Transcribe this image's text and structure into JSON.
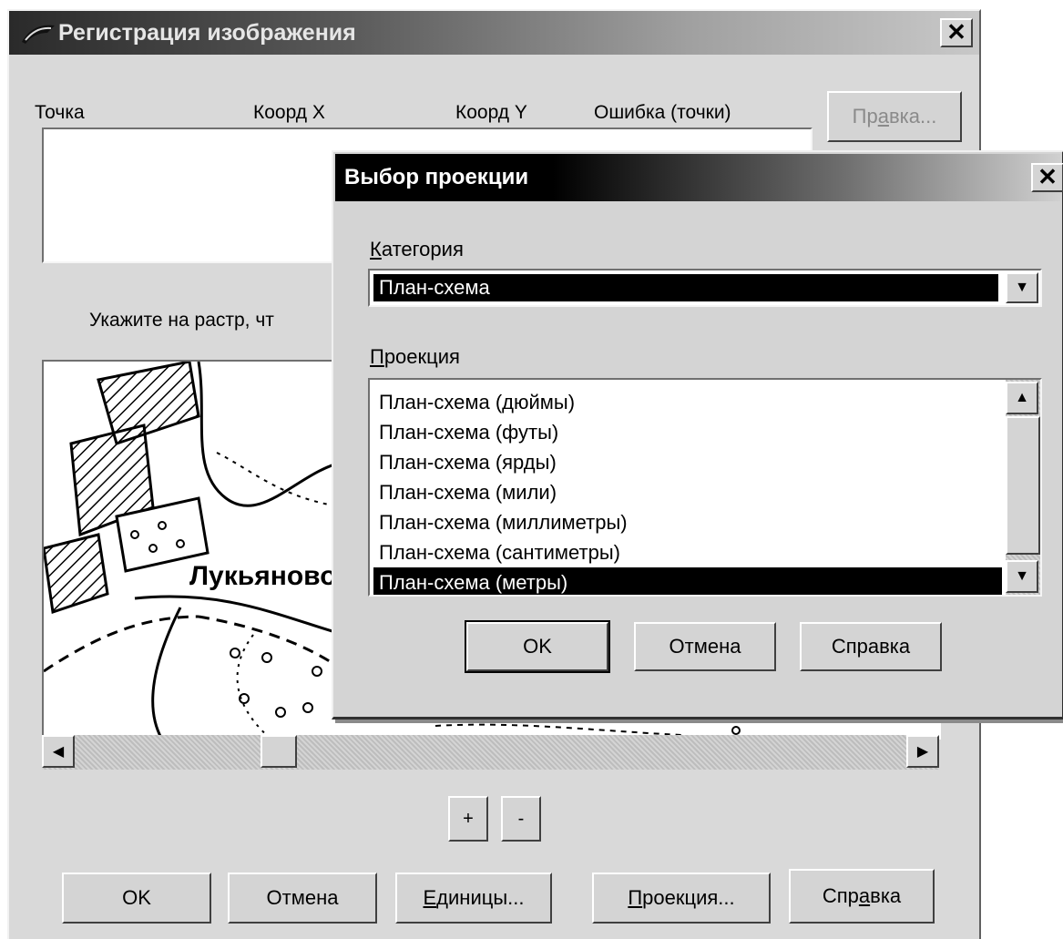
{
  "main_dialog": {
    "title": "Регистрация изображения",
    "columns": {
      "point": "Точка",
      "x": "Коорд X",
      "y": "Коорд Y",
      "error": "Ошибка (точки)"
    },
    "edit_button": {
      "before": "Пр",
      "accel": "а",
      "after": "вка..."
    },
    "instruction": "Укажите на растр, чт",
    "map_place_label": "Лукьяново",
    "zoom_in": "+",
    "zoom_out": "-",
    "ok": "OK",
    "cancel": "Отмена",
    "units": {
      "accel": "Е",
      "after": "диницы..."
    },
    "projection": {
      "accel": "П",
      "after": "роекция..."
    },
    "help": {
      "before": "Спр",
      "accel": "а",
      "after": "вка"
    }
  },
  "projection_dialog": {
    "title": "Выбор проекции",
    "category_label": {
      "accel": "К",
      "after": "атегория"
    },
    "category_value": "План-схема",
    "projection_label": {
      "accel": "П",
      "after": "роекция"
    },
    "projections": [
      "План-схема (дюймы)",
      "План-схема (футы)",
      "План-схема (ярды)",
      "План-схема (мили)",
      "План-схема (миллиметры)",
      "План-схема (сантиметры)",
      "План-схема (метры)"
    ],
    "selected_index": 6,
    "ok": "OK",
    "cancel": "Отмена",
    "help": "Справка"
  },
  "icons": [
    "app-icon",
    "close-icon",
    "combo-arrow-icon",
    "scroll-up-icon",
    "scroll-down-icon",
    "scroll-left-icon",
    "scroll-right-icon"
  ]
}
